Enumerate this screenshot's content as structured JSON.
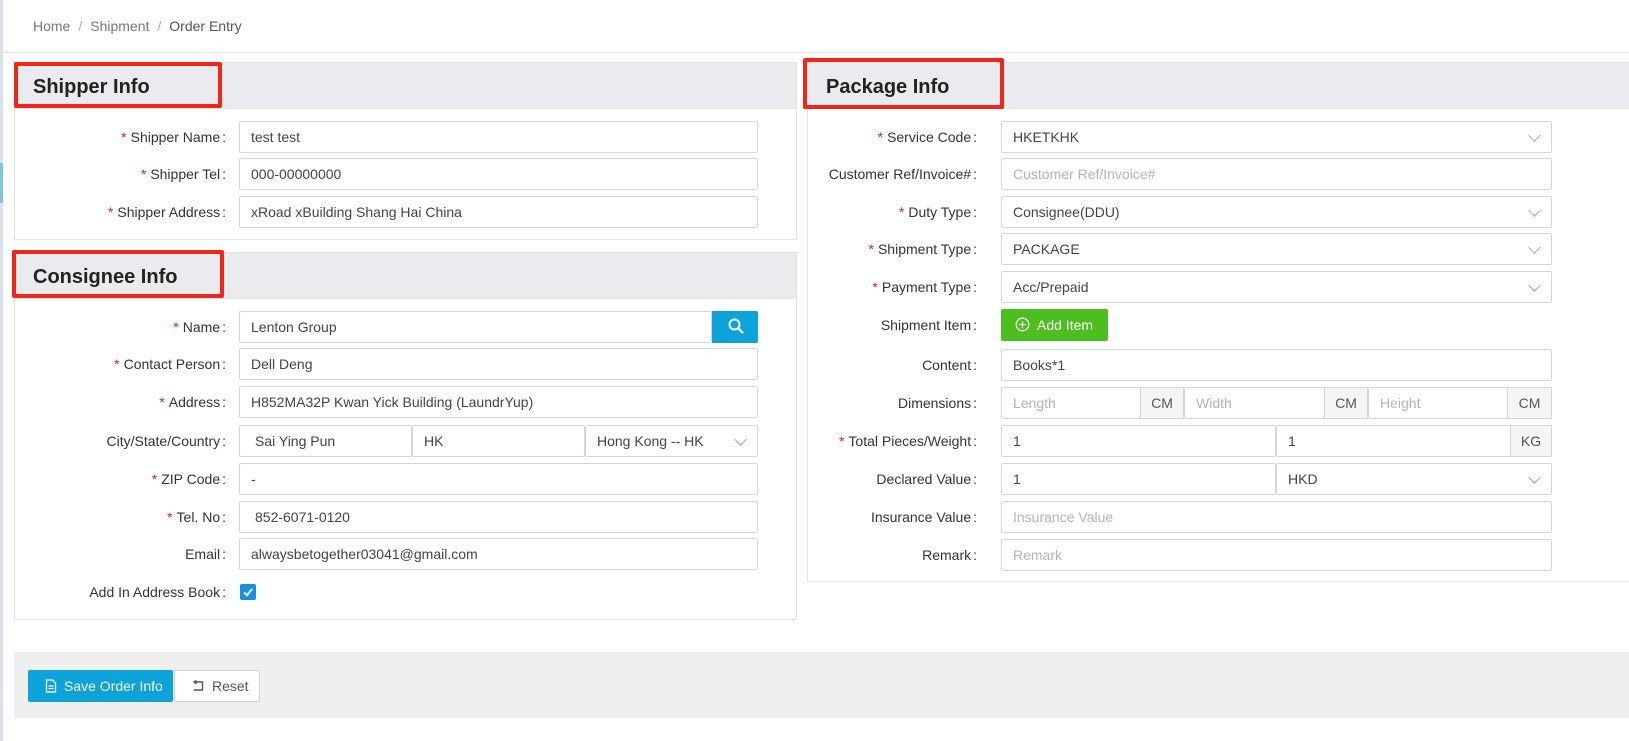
{
  "breadcrumb": {
    "home": "Home",
    "shipment": "Shipment",
    "current": "Order Entry",
    "separator": "/"
  },
  "shipper": {
    "title": "Shipper Info",
    "name_label": "Shipper Name",
    "name_value": "test test",
    "tel_label": "Shipper Tel",
    "tel_value": "000-00000000",
    "address_label": "Shipper Address",
    "address_value": "xRoad xBuilding Shang Hai China"
  },
  "consignee": {
    "title": "Consignee Info",
    "name_label": "Name",
    "name_value": "Lenton Group",
    "contact_label": "Contact Person",
    "contact_value": "Dell Deng",
    "address_label": "Address",
    "address_value": "H852MA32P Kwan Yick Building (LaundrYup)",
    "city_label": "City/State/Country",
    "city_value": "Sai Ying Pun",
    "state_value": "HK",
    "country_value": "Hong Kong -- HK",
    "zip_label": "ZIP Code",
    "zip_value": "-",
    "tel_label": "Tel. No",
    "tel_value": "852-6071-0120",
    "email_label": "Email",
    "email_value": "alwaysbetogether03041@gmail.com",
    "address_book_label": "Add In Address Book",
    "address_book_checked": true
  },
  "package": {
    "title": "Package Info",
    "service_code_label": "Service Code",
    "service_code_value": "HKETKHK",
    "customer_ref_label": "Customer Ref/Invoice#",
    "customer_ref_placeholder": "Customer Ref/Invoice#",
    "duty_type_label": "Duty Type",
    "duty_type_value": "Consignee(DDU)",
    "shipment_type_label": "Shipment Type",
    "shipment_type_value": "PACKAGE",
    "payment_type_label": "Payment Type",
    "payment_type_value": "Acc/Prepaid",
    "shipment_item_label": "Shipment Item",
    "add_item_label": "Add Item",
    "content_label": "Content",
    "content_value": "Books*1",
    "dimensions_label": "Dimensions",
    "length_placeholder": "Length",
    "width_placeholder": "Width",
    "height_placeholder": "Height",
    "dim_unit": "CM",
    "pieces_weight_label": "Total Pieces/Weight",
    "pieces_value": "1",
    "weight_value": "1",
    "weight_unit": "KG",
    "declared_label": "Declared Value",
    "declared_value": "1",
    "currency_value": "HKD",
    "insurance_label": "Insurance Value",
    "insurance_placeholder": "Insurance Value",
    "remark_label": "Remark",
    "remark_placeholder": "Remark"
  },
  "actions": {
    "save_label": "Save Order Info",
    "reset_label": "Reset"
  },
  "colors": {
    "primary": "#0ba3d9",
    "success": "#4cbe1f",
    "required": "#e0221c",
    "highlight": "#f0261b"
  }
}
